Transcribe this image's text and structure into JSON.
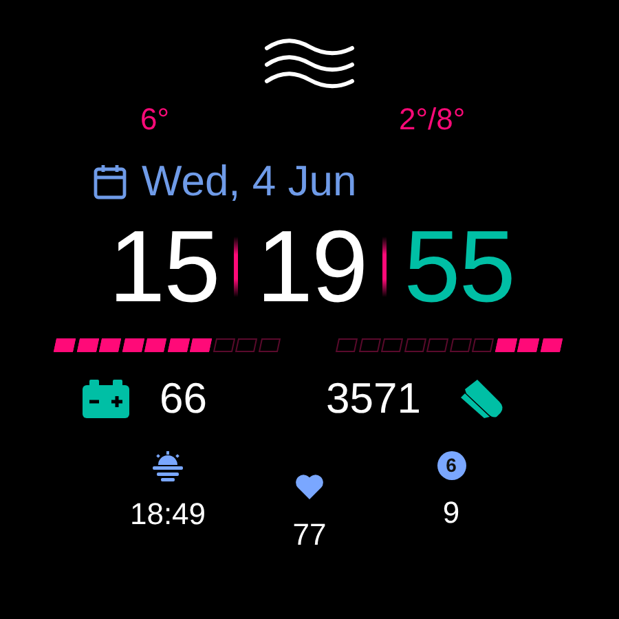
{
  "weather": {
    "current": "6°",
    "range": "2°/8°"
  },
  "date": "Wed, 4 Jun",
  "time": {
    "hours": "15",
    "minutes": "19",
    "seconds": "55"
  },
  "battery": {
    "level": 0.7,
    "value": "66"
  },
  "steps": {
    "level": 0.3,
    "value": "3571"
  },
  "sunset": "18:49",
  "heart_rate": "77",
  "notifications": {
    "badge": "6",
    "value": "9"
  }
}
